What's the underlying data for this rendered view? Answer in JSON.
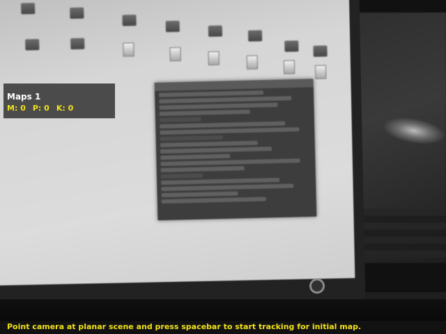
{
  "hud": {
    "title": "Maps 1",
    "stats": [
      {
        "label": "M:",
        "value": "0"
      },
      {
        "label": "P:",
        "value": "0"
      },
      {
        "label": "K:",
        "value": "0"
      }
    ]
  },
  "status": {
    "message": "Point camera at planar scene and press spacebar to start tracking for initial map."
  },
  "colors": {
    "hud_title": "#ffffff",
    "hud_stats": "#f2e21a",
    "status_text": "#f2e21a"
  }
}
